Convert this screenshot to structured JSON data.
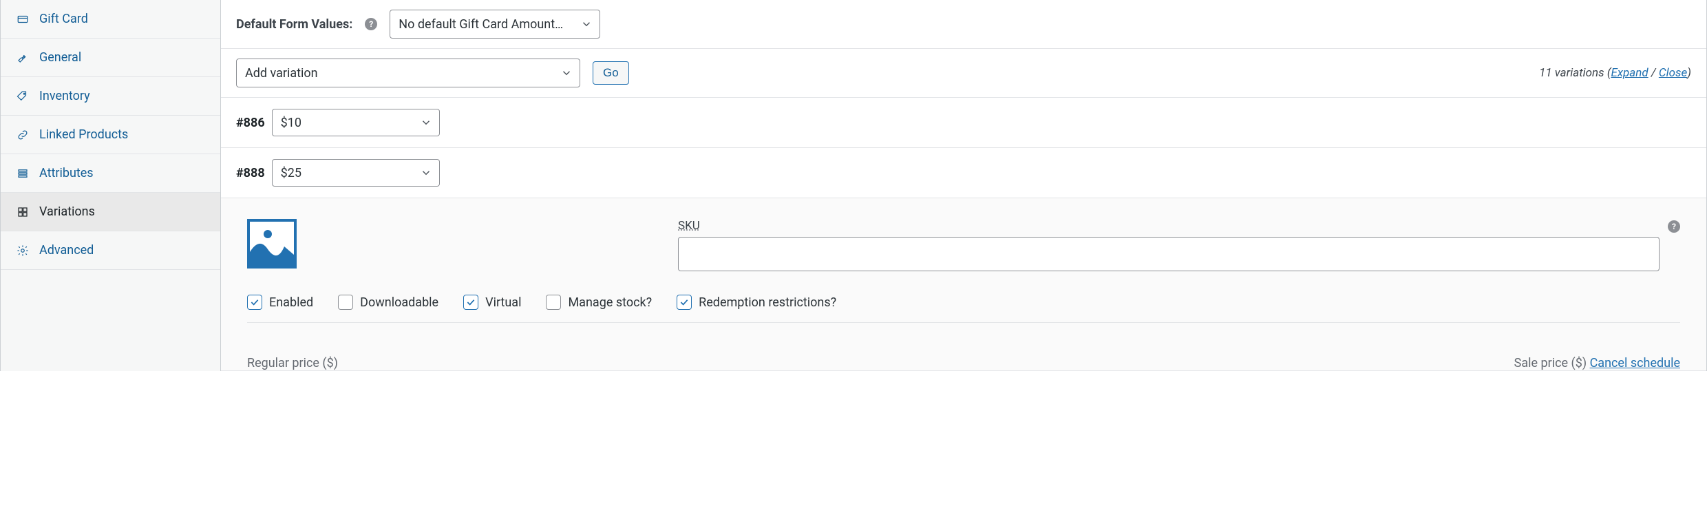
{
  "sidebar": {
    "items": [
      {
        "label": "Gift Card"
      },
      {
        "label": "General"
      },
      {
        "label": "Inventory"
      },
      {
        "label": "Linked Products"
      },
      {
        "label": "Attributes"
      },
      {
        "label": "Variations"
      },
      {
        "label": "Advanced"
      }
    ]
  },
  "default_form": {
    "label": "Default Form Values:",
    "selected": "No default Gift Card Amount…"
  },
  "add_variation": {
    "selected": "Add variation",
    "go": "Go"
  },
  "variations_meta": {
    "count": "11 variations",
    "expand": "Expand",
    "close": "Close"
  },
  "variations": [
    {
      "id": "#886",
      "selected": "$10"
    },
    {
      "id": "#888",
      "selected": "$25"
    }
  ],
  "panel": {
    "sku_label": "SKU",
    "sku_value": "",
    "checkboxes": {
      "enabled": {
        "label": "Enabled",
        "checked": true
      },
      "downloadable": {
        "label": "Downloadable",
        "checked": false
      },
      "virtual": {
        "label": "Virtual",
        "checked": true
      },
      "manage_stock": {
        "label": "Manage stock?",
        "checked": false
      },
      "redemption": {
        "label": "Redemption restrictions?",
        "checked": true
      }
    },
    "regular_price_label": "Regular price ($)",
    "sale_price_label": "Sale price ($) ",
    "cancel_schedule": "Cancel schedule"
  }
}
